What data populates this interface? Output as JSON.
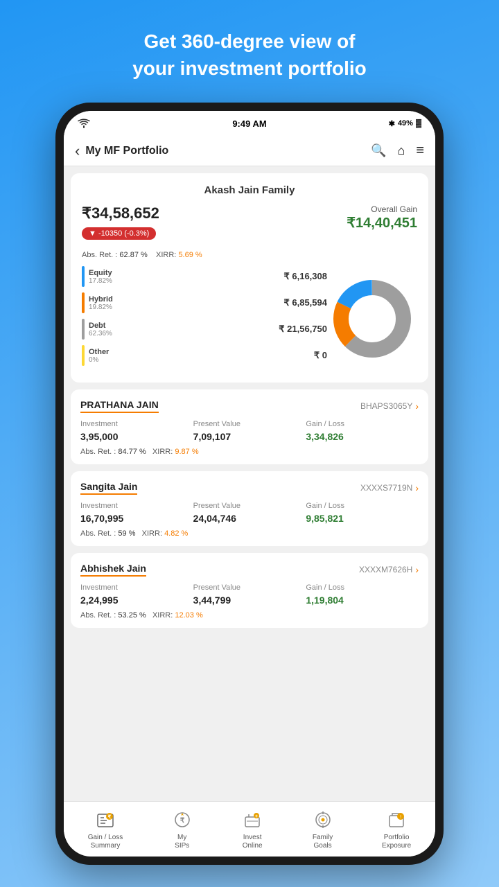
{
  "header": {
    "line1": "Get 360-degree view of",
    "line2": "your investment portfolio"
  },
  "statusBar": {
    "time": "9:49 AM",
    "battery": "49%",
    "bluetooth": "⚡",
    "wifi": "▲"
  },
  "navBar": {
    "title": "My MF Portfolio",
    "back": "‹",
    "search": "🔍",
    "home": "⌂",
    "menu": "≡"
  },
  "portfolio": {
    "family_name": "Akash Jain Family",
    "total_amount": "₹34,58,652",
    "loss_badge": "▼ -10350  (-0.3%)",
    "overall_gain_label": "Overall Gain",
    "overall_gain_amount": "₹14,40,451",
    "abs_ret_label": "Abs. Ret. :",
    "abs_ret_value": "62.87 %",
    "xirr_label": "XIRR:",
    "xirr_value": "5.69 %",
    "segments": [
      {
        "name": "Equity",
        "pct": "17.82%",
        "amount": "₹ 6,16,308",
        "color": "#2196f3"
      },
      {
        "name": "Hybrid",
        "pct": "19.82%",
        "amount": "₹ 6,85,594",
        "color": "#f57c00"
      },
      {
        "name": "Debt",
        "pct": "62.36%",
        "amount": "₹ 21,56,750",
        "color": "#9e9e9e"
      },
      {
        "name": "Other",
        "pct": "0%",
        "amount": "₹ 0",
        "color": "#fdd835"
      }
    ]
  },
  "members": [
    {
      "name": "PRATHANA JAIN",
      "pan": "BHAPS3065Y",
      "investment": "3,95,000",
      "present_value": "7,09,107",
      "gain_loss": "3,34,826",
      "abs_ret": "84.77 %",
      "xirr": "9.87 %"
    },
    {
      "name": "Sangita Jain",
      "pan": "XXXXS7719N",
      "investment": "16,70,995",
      "present_value": "24,04,746",
      "gain_loss": "9,85,821",
      "abs_ret": "59 %",
      "xirr": "4.82 %"
    },
    {
      "name": "Abhishek Jain",
      "pan": "XXXXM7626H",
      "investment": "2,24,995",
      "present_value": "3,44,799",
      "gain_loss": "1,19,804",
      "abs_ret": "53.25 %",
      "xirr": "12.03 %"
    }
  ],
  "bottomNav": [
    {
      "label": "Gain / Loss\nSummary",
      "icon": "gain-loss"
    },
    {
      "label": "My\nSIPs",
      "icon": "sips"
    },
    {
      "label": "Invest\nOnline",
      "icon": "invest"
    },
    {
      "label": "Family\nGoals",
      "icon": "goals"
    },
    {
      "label": "Portfolio\nExposure",
      "icon": "exposure"
    }
  ]
}
